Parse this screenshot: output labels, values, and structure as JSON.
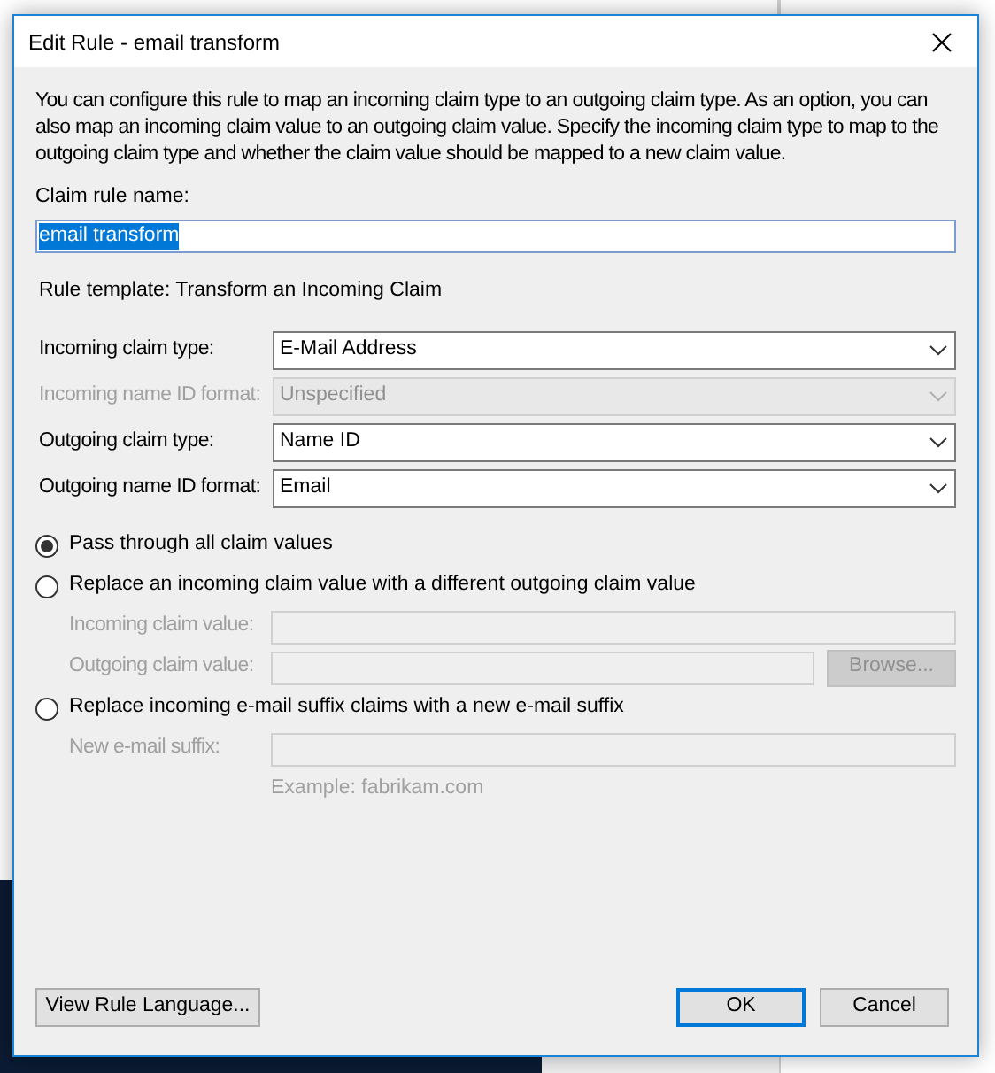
{
  "window": {
    "title": "Edit Rule - email transform"
  },
  "description": "You can configure this rule to map an incoming claim type to an outgoing claim type. As an option, you can also map an incoming claim value to an outgoing claim value. Specify the incoming claim type to map to the outgoing claim type and whether the claim value should be mapped to a new claim value.",
  "rule_name": {
    "label": "Claim rule name:",
    "value": "email transform"
  },
  "rule_template": "Rule template: Transform an Incoming Claim",
  "dropdowns": [
    {
      "label": "Incoming claim type:",
      "value": "E-Mail Address",
      "disabled": false
    },
    {
      "label": "Incoming name ID format:",
      "value": "Unspecified",
      "disabled": true
    },
    {
      "label": "Outgoing claim type:",
      "value": "Name ID",
      "disabled": false
    },
    {
      "label": "Outgoing name ID format:",
      "value": "Email",
      "disabled": false
    }
  ],
  "options": [
    {
      "label": "Pass through all claim values",
      "selected": true
    },
    {
      "label": "Replace an incoming claim value with a different outgoing claim value",
      "selected": false,
      "fields": [
        {
          "label": "Incoming claim value:"
        },
        {
          "label": "Outgoing claim value:",
          "button": "Browse..."
        }
      ]
    },
    {
      "label": "Replace incoming e-mail suffix claims with a new e-mail suffix",
      "selected": false,
      "fields": [
        {
          "label": "New e-mail suffix:",
          "hint": "Example: fabrikam.com"
        }
      ]
    }
  ],
  "buttons": {
    "view_rule_language": "View Rule Language...",
    "ok": "OK",
    "cancel": "Cancel"
  }
}
